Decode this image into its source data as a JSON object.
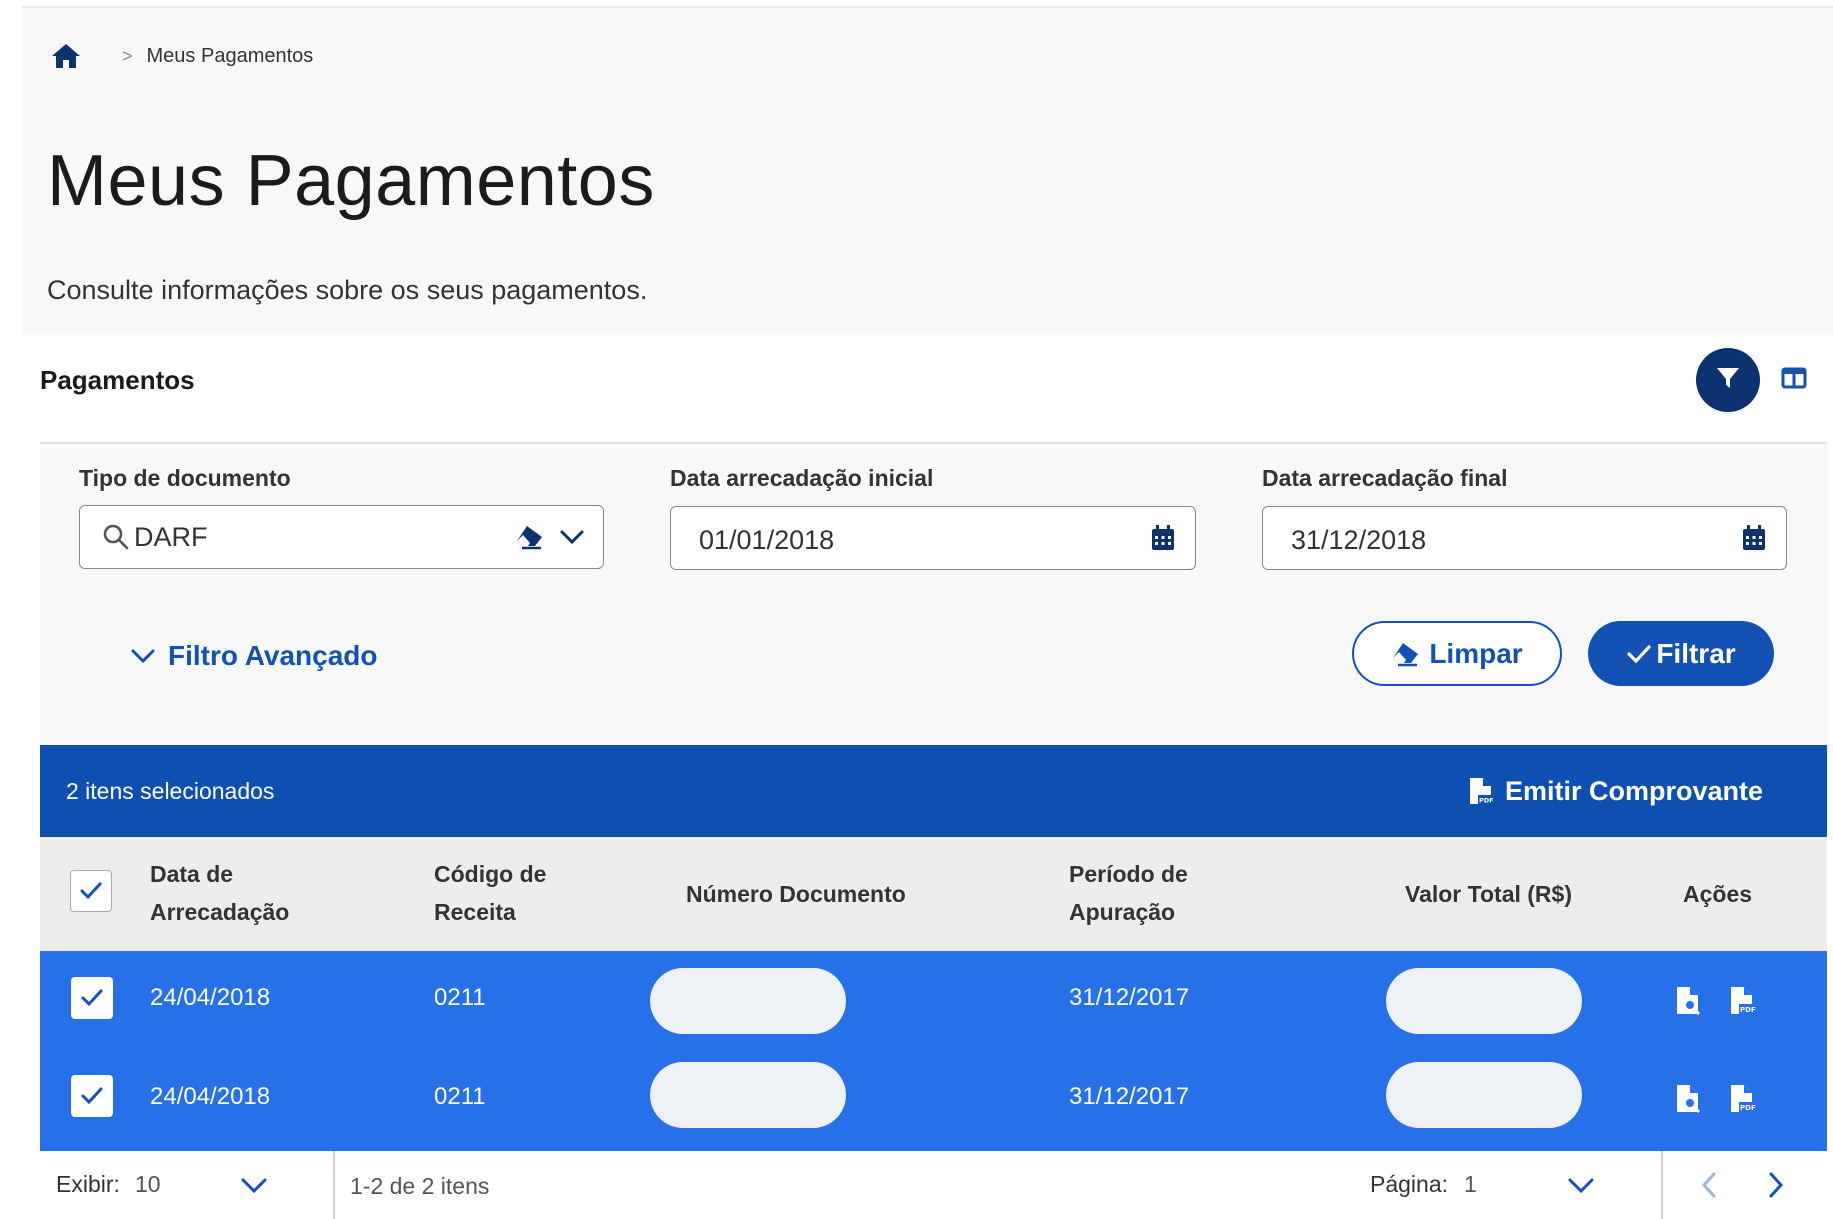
{
  "breadcrumb": {
    "current": "Meus Pagamentos"
  },
  "page": {
    "title": "Meus Pagamentos",
    "subtitle": "Consulte informações sobre os seus pagamentos."
  },
  "card": {
    "title": "Pagamentos"
  },
  "filters": {
    "tipo_label": "Tipo de documento",
    "tipo_value": "DARF",
    "data_inicial_label": "Data arrecadação inicial",
    "data_inicial_value": "01/01/2018",
    "data_final_label": "Data arrecadação final",
    "data_final_value": "31/12/2018",
    "advanced_label": "Filtro Avançado",
    "clear_label": "Limpar",
    "apply_label": "Filtrar"
  },
  "selection": {
    "count_text": "2 itens selecionados",
    "emit_label": "Emitir Comprovante"
  },
  "table": {
    "headers": {
      "data_1": "Data de",
      "data_2": "Arrecadação",
      "codigo_1": "Código de",
      "codigo_2": "Receita",
      "numero": "Número Documento",
      "periodo_1": "Período de",
      "periodo_2": "Apuração",
      "valor": "Valor Total (R$)",
      "acoes": "Ações"
    },
    "rows": [
      {
        "data": "24/04/2018",
        "codigo": "0211",
        "periodo": "31/12/2017",
        "checked": true
      },
      {
        "data": "24/04/2018",
        "codigo": "0211",
        "periodo": "31/12/2017",
        "checked": true
      }
    ]
  },
  "pagination": {
    "show_label": "Exibir:",
    "show_value": "10",
    "range_text": "1-2 de 2 itens",
    "page_label": "Página:",
    "page_value": "1"
  },
  "colors": {
    "primary": "#1351b4",
    "dark_blue": "#0c326f",
    "selected_row": "#2670e8",
    "selection_bar": "#0f4fb2"
  }
}
